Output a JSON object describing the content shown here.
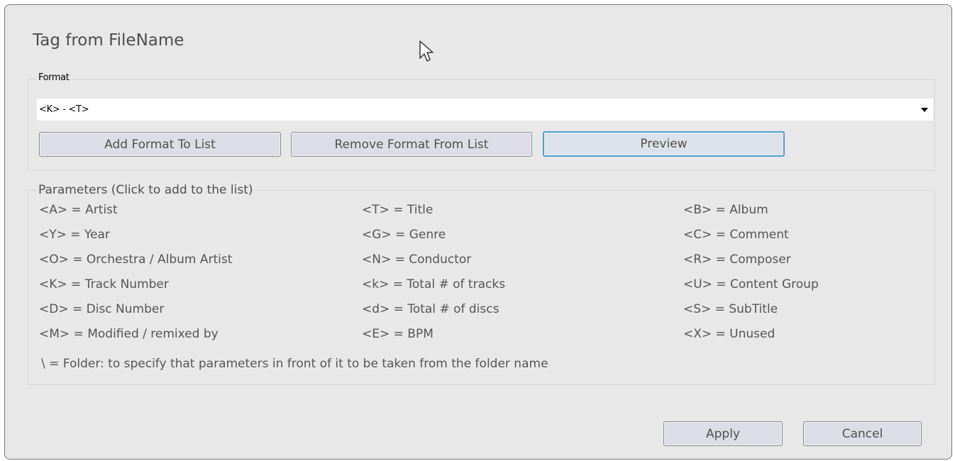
{
  "dialog": {
    "title": "Tag from FileName"
  },
  "format": {
    "label": "Format",
    "value": "<K> - <T>",
    "buttons": {
      "add": "Add Format To List",
      "remove": "Remove Format From List",
      "preview": "Preview"
    }
  },
  "parameters": {
    "label": "Parameters (Click to add to the list)",
    "rows": [
      [
        "<A> = Artist",
        "<T> = Title",
        "<B> = Album"
      ],
      [
        "<Y> = Year",
        "<G> = Genre",
        "<C> = Comment"
      ],
      [
        "<O> = Orchestra / Album Artist",
        "<N> = Conductor",
        "<R> = Composer"
      ],
      [
        "<K> = Track Number",
        "<k> = Total # of tracks",
        "<U> = Content Group"
      ],
      [
        "<D> = Disc Number",
        "<d> = Total # of discs",
        "<S> = SubTitle"
      ],
      [
        "<M> = Modified / remixed by",
        "<E> = BPM",
        "<X> = Unused"
      ]
    ],
    "folder_note": "\\ = Folder: to specify that parameters in front of it to be taken from the folder name"
  },
  "footer": {
    "apply": "Apply",
    "cancel": "Cancel"
  }
}
